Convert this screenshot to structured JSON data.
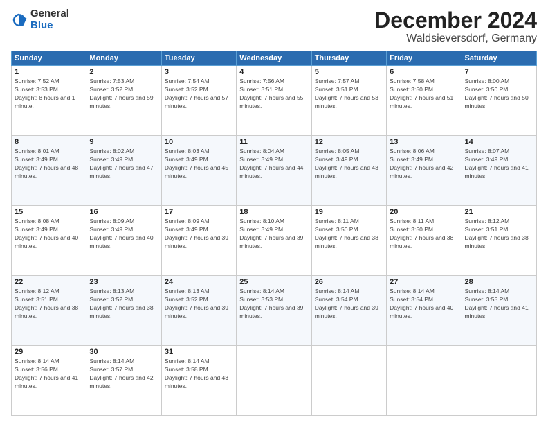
{
  "logo": {
    "general": "General",
    "blue": "Blue"
  },
  "title": {
    "month_year": "December 2024",
    "location": "Waldsieversdorf, Germany"
  },
  "headers": [
    "Sunday",
    "Monday",
    "Tuesday",
    "Wednesday",
    "Thursday",
    "Friday",
    "Saturday"
  ],
  "weeks": [
    [
      {
        "day": "1",
        "sunrise": "7:52 AM",
        "sunset": "3:53 PM",
        "daylight": "8 hours and 1 minute."
      },
      {
        "day": "2",
        "sunrise": "7:53 AM",
        "sunset": "3:52 PM",
        "daylight": "7 hours and 59 minutes."
      },
      {
        "day": "3",
        "sunrise": "7:54 AM",
        "sunset": "3:52 PM",
        "daylight": "7 hours and 57 minutes."
      },
      {
        "day": "4",
        "sunrise": "7:56 AM",
        "sunset": "3:51 PM",
        "daylight": "7 hours and 55 minutes."
      },
      {
        "day": "5",
        "sunrise": "7:57 AM",
        "sunset": "3:51 PM",
        "daylight": "7 hours and 53 minutes."
      },
      {
        "day": "6",
        "sunrise": "7:58 AM",
        "sunset": "3:50 PM",
        "daylight": "7 hours and 51 minutes."
      },
      {
        "day": "7",
        "sunrise": "8:00 AM",
        "sunset": "3:50 PM",
        "daylight": "7 hours and 50 minutes."
      }
    ],
    [
      {
        "day": "8",
        "sunrise": "8:01 AM",
        "sunset": "3:49 PM",
        "daylight": "7 hours and 48 minutes."
      },
      {
        "day": "9",
        "sunrise": "8:02 AM",
        "sunset": "3:49 PM",
        "daylight": "7 hours and 47 minutes."
      },
      {
        "day": "10",
        "sunrise": "8:03 AM",
        "sunset": "3:49 PM",
        "daylight": "7 hours and 45 minutes."
      },
      {
        "day": "11",
        "sunrise": "8:04 AM",
        "sunset": "3:49 PM",
        "daylight": "7 hours and 44 minutes."
      },
      {
        "day": "12",
        "sunrise": "8:05 AM",
        "sunset": "3:49 PM",
        "daylight": "7 hours and 43 minutes."
      },
      {
        "day": "13",
        "sunrise": "8:06 AM",
        "sunset": "3:49 PM",
        "daylight": "7 hours and 42 minutes."
      },
      {
        "day": "14",
        "sunrise": "8:07 AM",
        "sunset": "3:49 PM",
        "daylight": "7 hours and 41 minutes."
      }
    ],
    [
      {
        "day": "15",
        "sunrise": "8:08 AM",
        "sunset": "3:49 PM",
        "daylight": "7 hours and 40 minutes."
      },
      {
        "day": "16",
        "sunrise": "8:09 AM",
        "sunset": "3:49 PM",
        "daylight": "7 hours and 40 minutes."
      },
      {
        "day": "17",
        "sunrise": "8:09 AM",
        "sunset": "3:49 PM",
        "daylight": "7 hours and 39 minutes."
      },
      {
        "day": "18",
        "sunrise": "8:10 AM",
        "sunset": "3:49 PM",
        "daylight": "7 hours and 39 minutes."
      },
      {
        "day": "19",
        "sunrise": "8:11 AM",
        "sunset": "3:50 PM",
        "daylight": "7 hours and 38 minutes."
      },
      {
        "day": "20",
        "sunrise": "8:11 AM",
        "sunset": "3:50 PM",
        "daylight": "7 hours and 38 minutes."
      },
      {
        "day": "21",
        "sunrise": "8:12 AM",
        "sunset": "3:51 PM",
        "daylight": "7 hours and 38 minutes."
      }
    ],
    [
      {
        "day": "22",
        "sunrise": "8:12 AM",
        "sunset": "3:51 PM",
        "daylight": "7 hours and 38 minutes."
      },
      {
        "day": "23",
        "sunrise": "8:13 AM",
        "sunset": "3:52 PM",
        "daylight": "7 hours and 38 minutes."
      },
      {
        "day": "24",
        "sunrise": "8:13 AM",
        "sunset": "3:52 PM",
        "daylight": "7 hours and 39 minutes."
      },
      {
        "day": "25",
        "sunrise": "8:14 AM",
        "sunset": "3:53 PM",
        "daylight": "7 hours and 39 minutes."
      },
      {
        "day": "26",
        "sunrise": "8:14 AM",
        "sunset": "3:54 PM",
        "daylight": "7 hours and 39 minutes."
      },
      {
        "day": "27",
        "sunrise": "8:14 AM",
        "sunset": "3:54 PM",
        "daylight": "7 hours and 40 minutes."
      },
      {
        "day": "28",
        "sunrise": "8:14 AM",
        "sunset": "3:55 PM",
        "daylight": "7 hours and 41 minutes."
      }
    ],
    [
      {
        "day": "29",
        "sunrise": "8:14 AM",
        "sunset": "3:56 PM",
        "daylight": "7 hours and 41 minutes."
      },
      {
        "day": "30",
        "sunrise": "8:14 AM",
        "sunset": "3:57 PM",
        "daylight": "7 hours and 42 minutes."
      },
      {
        "day": "31",
        "sunrise": "8:14 AM",
        "sunset": "3:58 PM",
        "daylight": "7 hours and 43 minutes."
      },
      null,
      null,
      null,
      null
    ]
  ]
}
